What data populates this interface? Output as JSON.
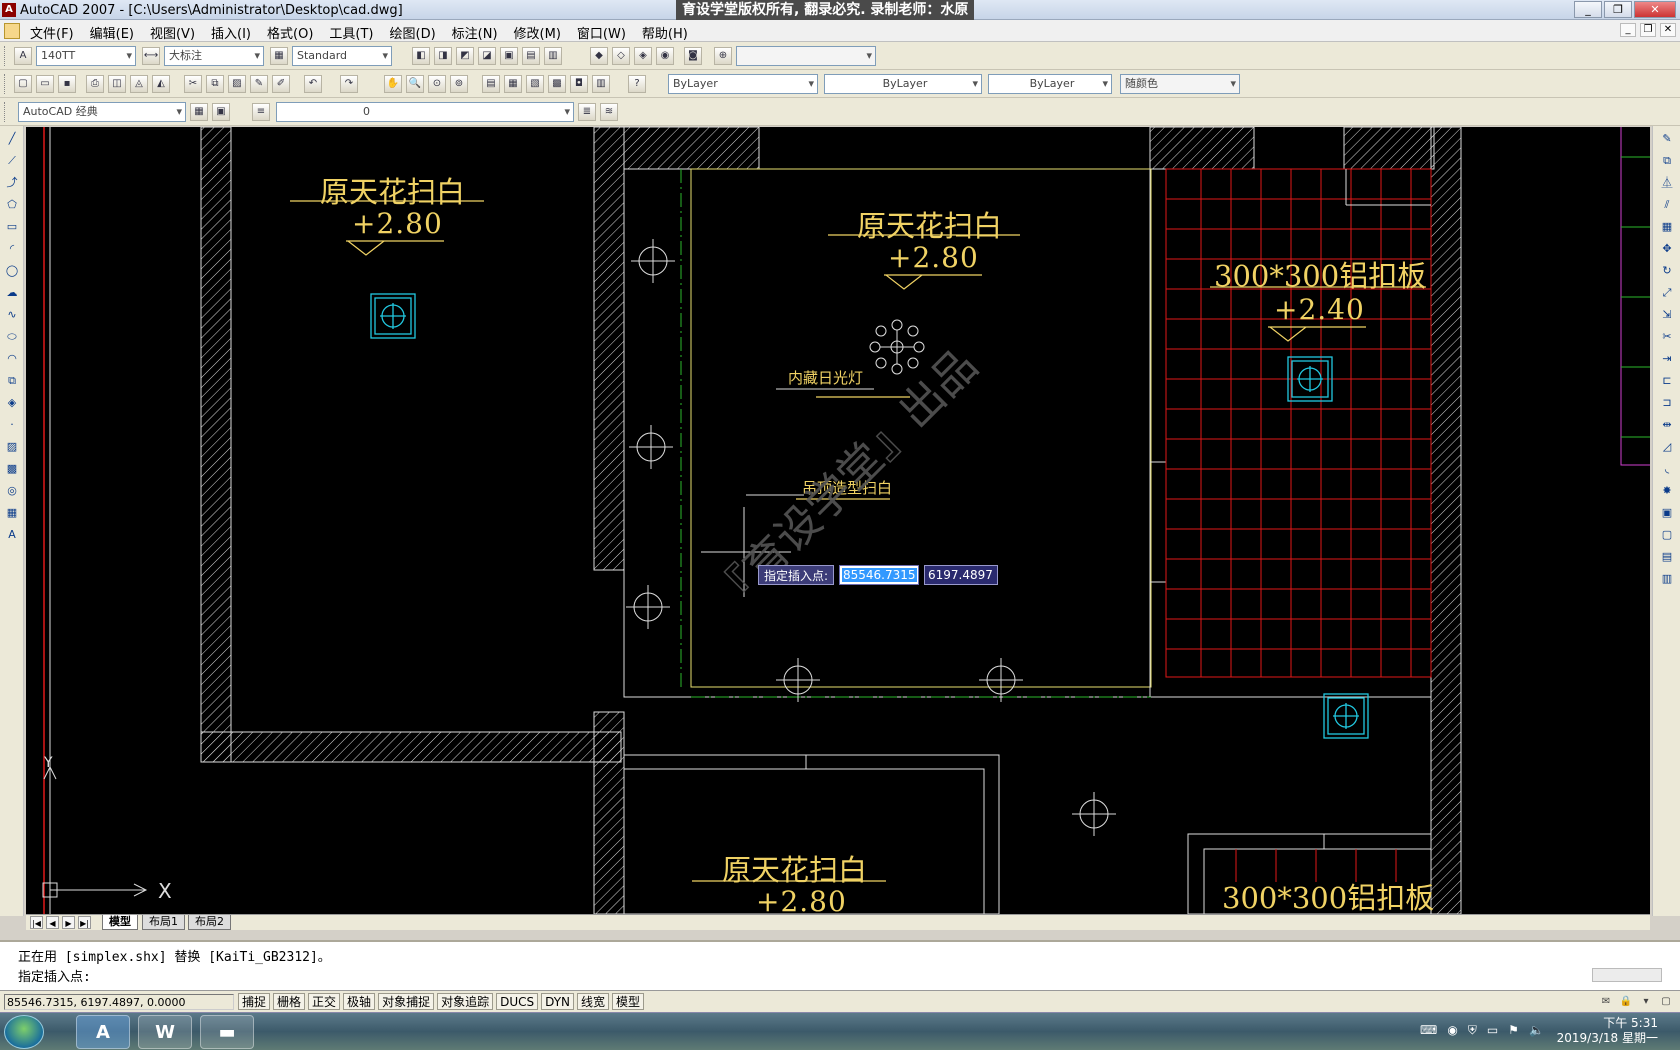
{
  "window": {
    "title": "AutoCAD 2007 - [C:\\Users\\Administrator\\Desktop\\cad.dwg]",
    "banner": "育设学堂版权所有, 翻录必究. 录制老师：水原",
    "app_icon": "autocad-icon",
    "controls": [
      "_",
      "❐",
      "✕"
    ]
  },
  "menu": {
    "items": [
      "文件(F)",
      "编辑(E)",
      "视图(V)",
      "插入(I)",
      "格式(O)",
      "工具(T)",
      "绘图(D)",
      "标注(N)",
      "修改(M)",
      "窗口(W)",
      "帮助(H)"
    ],
    "mdi_controls": [
      "_",
      "❐",
      "✕"
    ]
  },
  "toolbar1": {
    "text_style": "140TT",
    "dim_style": "大标注",
    "table_style": "Standard",
    "empty_combo": ""
  },
  "toolbar2": {
    "color": "ByLayer",
    "linetype": "ByLayer",
    "lineweight": "ByLayer",
    "plotstyle": "随颜色"
  },
  "toolbar3": {
    "workspace": "AutoCAD 经典",
    "layer": "0"
  },
  "drawing": {
    "room_label_1": "原天花扫白",
    "level_1": "+2.80",
    "room_label_2": "原天花扫白",
    "level_2": "+2.80",
    "room_label_3": "300*300铝扣板",
    "level_3": "+2.40",
    "room_label_4": "原天花扫白",
    "level_4": "+2.80",
    "room_label_5": "300*300铝扣板",
    "note_1": "内藏日光灯",
    "note_2": "吊顶造型扫白",
    "watermark": "『育设学堂』出品",
    "ucs_x": "X",
    "ucs_y": "Y"
  },
  "dynamic_input": {
    "prompt": "指定插入点:",
    "x_value": "85546.7315",
    "y_value": "6197.4897"
  },
  "layout_tabs": {
    "model": "模型",
    "layout1": "布局1",
    "layout2": "布局2"
  },
  "command_line": {
    "line1": "正在用 [simplex.shx] 替换 [KaiTi_GB2312]。",
    "line2": "指定插入点:"
  },
  "status": {
    "coords": "85546.7315,  6197.4897,  0.0000",
    "modes": [
      "捕捉",
      "栅格",
      "正交",
      "极轴",
      "对象捕捉",
      "对象追踪",
      "DUCS",
      "DYN",
      "线宽",
      "模型"
    ]
  },
  "taskbar": {
    "time": "下午 5:31",
    "date": "2019/3/18 星期一",
    "apps": [
      "autocad-taskbar-icon",
      "word-taskbar-icon",
      "explorer-taskbar-icon"
    ]
  },
  "colors": {
    "canvas_bg": "#000000",
    "text_yellow": "#f0d264",
    "hatch_white": "#ffffff",
    "grid_red": "#e01818",
    "light_cyan": "#22c8e0",
    "dim_green": "#2cb82c"
  }
}
